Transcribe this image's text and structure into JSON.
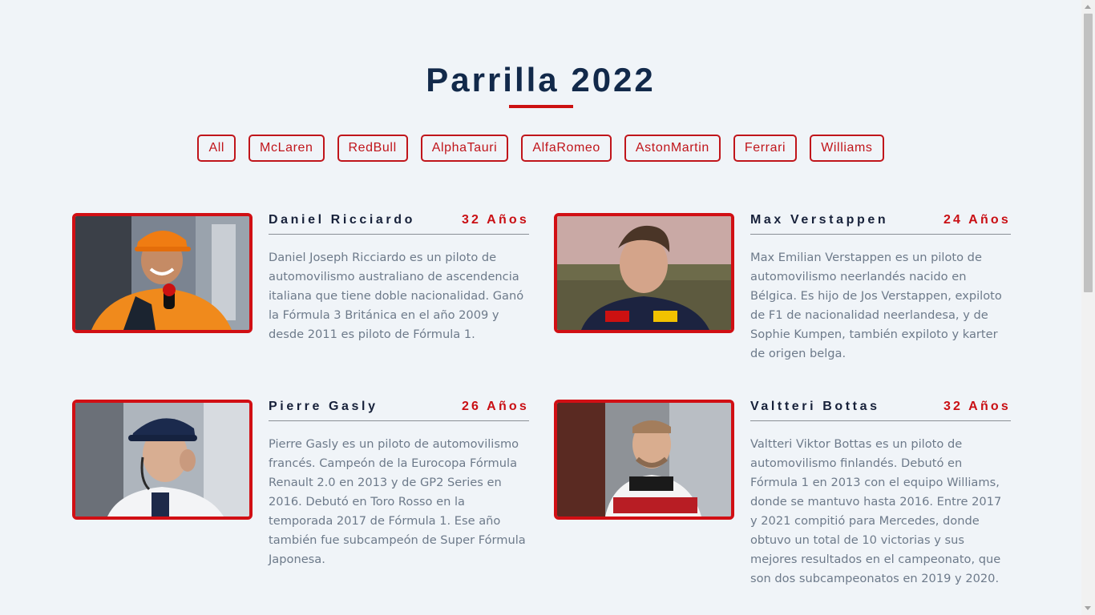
{
  "page": {
    "title": "Parrilla 2022"
  },
  "filters": [
    "All",
    "McLaren",
    "RedBull",
    "AlphaTauri",
    "AlfaRomeo",
    "AstonMartin",
    "Ferrari",
    "Williams"
  ],
  "drivers": [
    {
      "name": "Daniel Ricciardo",
      "age": "32 Años",
      "bio": "Daniel Joseph Ricciardo es un piloto de automovilismo australiano de ascendencia italiana que tiene doble nacionalidad. Ganó la Fórmula 3 Británica en el año 2009 y desde 2011 es piloto de Fórmula 1.",
      "photo_icon": "driver-photo-mclaren"
    },
    {
      "name": "Max Verstappen",
      "age": "24 Años",
      "bio": "Max Emilian Verstappen es un piloto de automovilismo neerlandés nacido en Bélgica. Es hijo de Jos Verstappen, expiloto de F1 de nacionalidad neerlandesa, y de Sophie Kumpen,  también expiloto y karter de origen belga.",
      "photo_icon": "driver-photo-redbull"
    },
    {
      "name": "Pierre Gasly",
      "age": "26 Años",
      "bio": "Pierre Gasly es un piloto de automovilismo francés. Campeón de la Eurocopa Fórmula Renault 2.0 en 2013 y de GP2 Series en 2016. Debutó en Toro Rosso en la temporada 2017 de Fórmula 1. Ese año también fue subcampeón de Super Fórmula Japonesa.",
      "photo_icon": "driver-photo-alphatauri"
    },
    {
      "name": "Valtteri Bottas",
      "age": "32 Años",
      "bio": "Valtteri Viktor Bottas es un piloto de automovilismo finlandés. Debutó en Fórmula 1 en 2013 con el equipo Williams, donde se mantuvo hasta 2016. Entre 2017 y 2021 compitió para Mercedes, donde obtuvo un total de 10 victorias y sus mejores resultados en el campeonato, que son dos subcampeonatos en 2019 y 2020.",
      "photo_icon": "driver-photo-alfaromeo"
    }
  ],
  "colors": {
    "accent": "#c0151b",
    "title": "#12294a",
    "background": "#f0f4f8",
    "bio_text": "#6d7a8a"
  }
}
